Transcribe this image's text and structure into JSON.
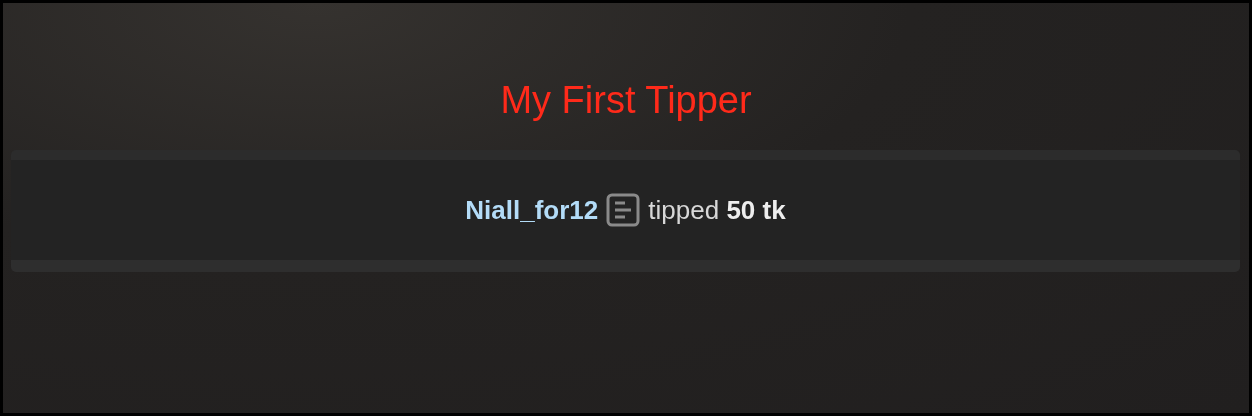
{
  "title": "My First Tipper",
  "tip": {
    "username": "Niall_for12",
    "message": "tipped **50 tk**"
  }
}
